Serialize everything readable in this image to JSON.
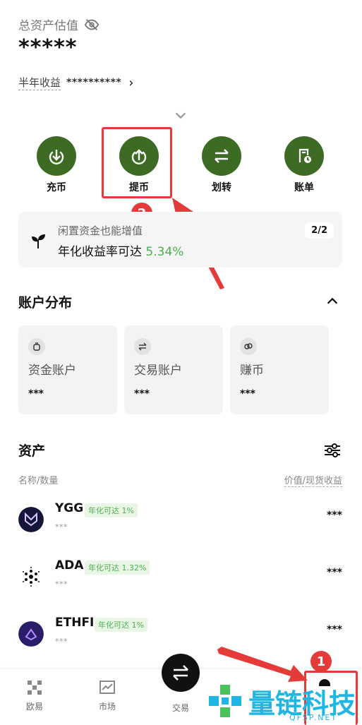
{
  "header": {
    "total_label": "总资产估值",
    "total_value": "*****",
    "half_year_label": "半年收益",
    "half_year_value": "**********"
  },
  "actions": [
    {
      "label": "充币",
      "icon": "arrow-down-circle-icon"
    },
    {
      "label": "提币",
      "icon": "arrow-up-circle-icon"
    },
    {
      "label": "划转",
      "icon": "transfer-icon"
    },
    {
      "label": "账单",
      "icon": "bill-icon"
    }
  ],
  "annotations": {
    "badge_2": "2",
    "badge_1": "1"
  },
  "promo": {
    "line1": "闲置资金也能增值",
    "line2_prefix": "年化收益率可达",
    "line2_pct": "5.34%",
    "page": "2/2"
  },
  "accounts": {
    "title": "账户分布",
    "items": [
      {
        "name": "资金账户",
        "value": "***"
      },
      {
        "name": "交易账户",
        "value": "***"
      },
      {
        "name": "赚币",
        "value": "***"
      }
    ]
  },
  "assets": {
    "title": "资产",
    "col_left": "名称/数量",
    "col_right": "价值/现货收益",
    "items": [
      {
        "symbol": "YGG",
        "tag": "年化可达 1%",
        "qty": "***",
        "value": "***"
      },
      {
        "symbol": "ADA",
        "tag": "年化可达 1.32%",
        "qty": "***",
        "value": "***"
      },
      {
        "symbol": "ETHFI",
        "tag": "年化可达 1%",
        "qty": "***",
        "value": "***"
      }
    ]
  },
  "nav": {
    "items": [
      {
        "label": "欧易"
      },
      {
        "label": "市场"
      },
      {
        "label": "交易"
      }
    ]
  },
  "watermark": {
    "text": "量链科技",
    "sub": "QFSP.NET"
  },
  "colors": {
    "accent_green": "#3d6b23",
    "annotation_red": "#e53a3a",
    "positive": "#4caf50"
  }
}
